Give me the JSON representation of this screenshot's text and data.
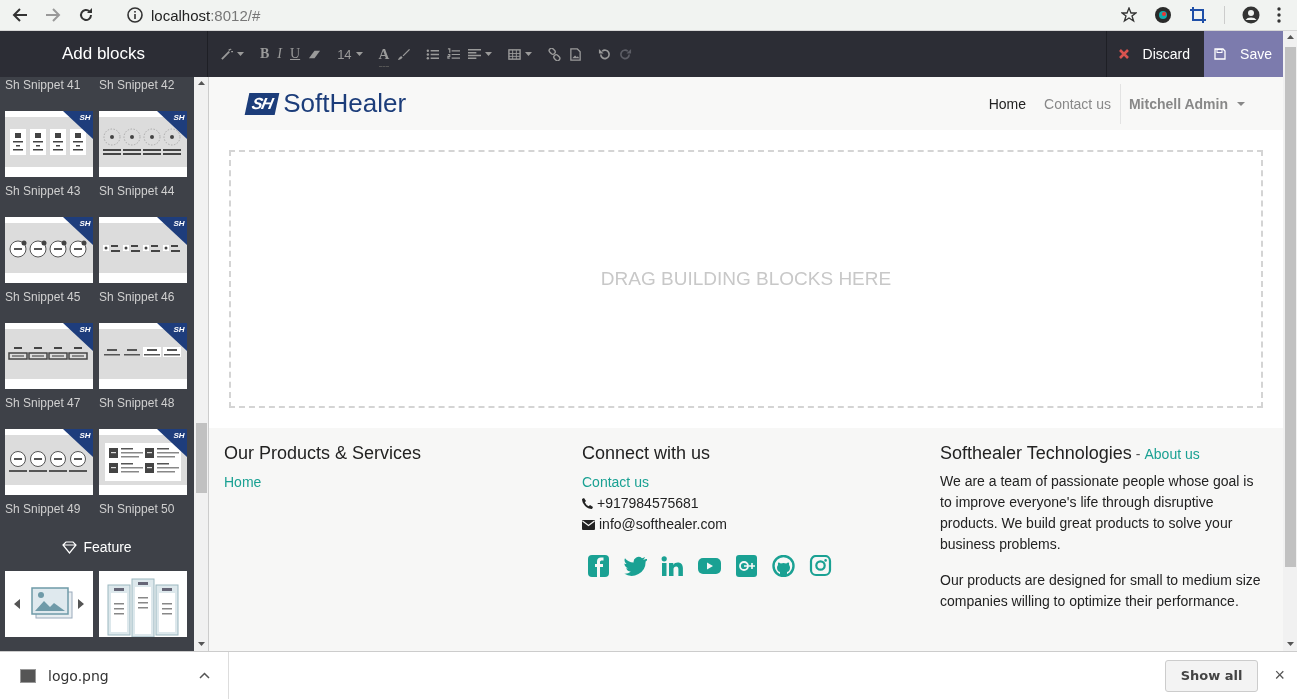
{
  "browser": {
    "url_host": "localhost",
    "url_rest": ":8012/#"
  },
  "editor": {
    "sidebar_title": "Add blocks",
    "toolbar": [
      [
        {
          "kind": "wand",
          "caret": true
        }
      ],
      [
        {
          "kind": "bold",
          "text": "B"
        },
        {
          "kind": "italic",
          "text": "I"
        },
        {
          "kind": "underline",
          "text": "U"
        },
        {
          "kind": "eraser",
          "caret": false
        }
      ],
      [
        {
          "kind": "size",
          "text": "14",
          "caret": true
        }
      ],
      [
        {
          "kind": "font-color",
          "text": "A"
        },
        {
          "kind": "brush",
          "caret": false
        }
      ],
      [
        {
          "kind": "bullets",
          "caret": false
        },
        {
          "kind": "numbers",
          "caret": false
        },
        {
          "kind": "align",
          "caret": true
        }
      ],
      [
        {
          "kind": "table",
          "caret": true
        }
      ],
      [
        {
          "kind": "link",
          "caret": false
        },
        {
          "kind": "image",
          "caret": false
        }
      ],
      [
        {
          "kind": "undo",
          "caret": false,
          "disabled": false
        },
        {
          "kind": "redo",
          "caret": false,
          "disabled": true
        }
      ]
    ],
    "discard": "Discard",
    "save": "Save"
  },
  "blocks": {
    "top_labels": [
      "Sh Snippet 41",
      "Sh Snippet 42"
    ],
    "snippets": [
      {
        "label": "Sh Snippet 43",
        "kind": "camera-cards",
        "badge": "SH"
      },
      {
        "label": "Sh Snippet 44",
        "kind": "target-circles",
        "badge": "SH"
      },
      {
        "label": "Sh Snippet 45",
        "kind": "badge-circles",
        "badge": "SH"
      },
      {
        "label": "Sh Snippet 46",
        "kind": "dot-lines",
        "badge": "SH"
      },
      {
        "label": "Sh Snippet 47",
        "kind": "framed-bars",
        "badge": "SH"
      },
      {
        "label": "Sh Snippet 48",
        "kind": "light-bars",
        "badge": "SH"
      },
      {
        "label": "Sh Snippet 49",
        "kind": "minus-circles",
        "badge": "SH"
      },
      {
        "label": "Sh Snippet 50",
        "kind": "image-text-grid",
        "badge": "SH"
      }
    ],
    "feature": {
      "title": "Feature",
      "items": [
        {
          "kind": "gallery"
        },
        {
          "kind": "comparison"
        }
      ]
    }
  },
  "site": {
    "logo": {
      "mark": "SH",
      "name": "SoftHealer"
    },
    "nav": [
      {
        "label": "Home",
        "selected": true
      },
      {
        "label": "Contact us",
        "selected": false
      }
    ],
    "user": "Mitchell Admin",
    "drop_zone": "DRAG BUILDING BLOCKS HERE",
    "footer": {
      "products": {
        "heading": "Our Products & Services",
        "links": [
          "Home"
        ]
      },
      "connect": {
        "heading": "Connect with us",
        "link": "Contact us",
        "phone": "+917984575681",
        "email": "info@softhealer.com",
        "socials": [
          {
            "kind": "facebook"
          },
          {
            "kind": "twitter"
          },
          {
            "kind": "linkedin"
          },
          {
            "kind": "youtube"
          },
          {
            "kind": "google-plus"
          },
          {
            "kind": "github"
          },
          {
            "kind": "instagram"
          }
        ]
      },
      "company": {
        "heading": "Softhealer Technologies",
        "separator": "-",
        "link": "About us",
        "paragraphs": [
          "We are a team of passionate people whose goal is to improve everyone's life through disruptive products. We build great products to solve your business problems.",
          "Our products are designed for small to medium size companies willing to optimize their performance."
        ]
      }
    }
  },
  "downloads": {
    "file": "logo.png",
    "show_all": "Show all",
    "close": "×"
  }
}
